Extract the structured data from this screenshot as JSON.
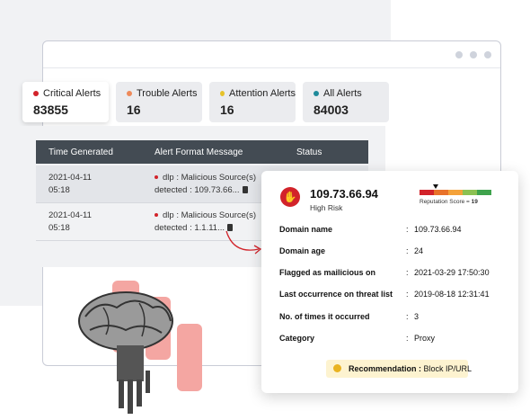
{
  "tabs": [
    {
      "label": "Critical Alerts",
      "count": "83855",
      "color": "#d2232a"
    },
    {
      "label": "Trouble Alerts",
      "count": "16",
      "color": "#ee8a5a"
    },
    {
      "label": "Attention Alerts",
      "count": "16",
      "color": "#e6c229"
    },
    {
      "label": "All Alerts",
      "count": "84003",
      "color": "#1f8a9a"
    }
  ],
  "table": {
    "headers": [
      "Time Generated",
      "Alert Format Message",
      "Status"
    ],
    "rows": [
      {
        "date": "2021-04-11",
        "time": "05:18",
        "msg1": "dlp : Malicious Source(s)",
        "msg2": "detected : 109.73.66..."
      },
      {
        "date": "2021-04-11",
        "time": "05:18",
        "msg1": "dlp : Malicious Source(s)",
        "msg2": "detected : 1.1.11..."
      }
    ]
  },
  "detail": {
    "ip": "109.73.66.94",
    "risk": "High Risk",
    "reputation_label": "Reputation Score = ",
    "reputation_score": "19",
    "reputation_colors": [
      "#d2232a",
      "#e8722a",
      "#f4a23a",
      "#8cc152",
      "#3fa34d"
    ],
    "fields": [
      {
        "label": "Domain name",
        "value": "109.73.66.94"
      },
      {
        "label": "Domain age",
        "value": "24"
      },
      {
        "label": "Flagged as mailicious on",
        "value": "2021-03-29 17:50:30"
      },
      {
        "label": "Last occurrence on threat list",
        "value": "2019-08-18 12:31:41"
      },
      {
        "label": "No. of times it occurred",
        "value": "3"
      },
      {
        "label": "Category",
        "value": "Proxy"
      }
    ],
    "recommendation_label": "Recommendation : ",
    "recommendation_value": "Block IP/URL"
  },
  "icons": [
    "hand-stop-icon",
    "lightbulb-icon",
    "file-icon",
    "browser-dot-icon"
  ]
}
